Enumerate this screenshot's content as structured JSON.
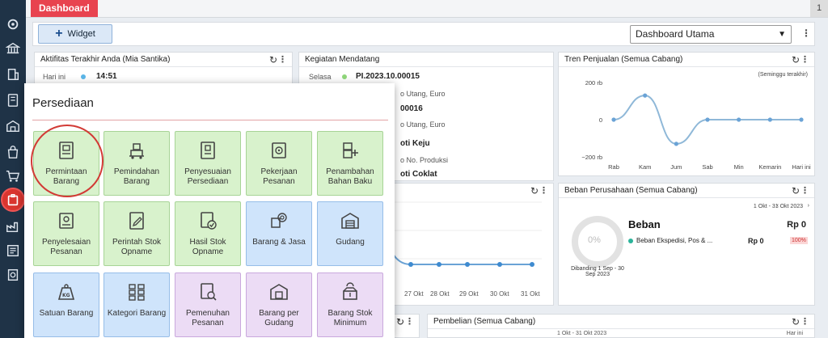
{
  "topbar": {
    "tab": "Dashboard",
    "right": "1"
  },
  "toolbar": {
    "widget_label": "Widget",
    "dashboard_select": "Dashboard Utama"
  },
  "activity": {
    "title": "Aktifitas Terakhir Anda (Mia Santika)",
    "row_label": "Hari ini",
    "row_time": "14:51"
  },
  "upcoming": {
    "title": "Kegiatan Mendatang",
    "status": "Selasa",
    "code": "PI.2023.10.00015",
    "lines": [
      "o Utang, Euro",
      "00016",
      "o Utang, Euro",
      "oti Keju",
      "o No. Produksi",
      "oti Coklat"
    ]
  },
  "sales": {
    "title": "Tren Penjualan (Semua Cabang)",
    "period": "(Seminggu terakhir)"
  },
  "expense": {
    "title": "Beban Perusahaan (Semua Cabang)",
    "range": "1 Okt - 31 Okt 2023",
    "donut_pct": "0%",
    "heading": "Beban",
    "total": "Rp 0",
    "item": "Beban Ekspedisi, Pos & ...",
    "item_value": "Rp 0",
    "item_pct": "100%",
    "compare": "Dibanding 1 Sep - 30 Sep 2023"
  },
  "middle_chart": {
    "xlabels": [
      "27 Okt",
      "28 Okt",
      "29 Okt",
      "30 Okt",
      "31 Okt"
    ]
  },
  "purchases": {
    "title": "Pembelian (Semua Cabang)",
    "range": "1 Okt - 31 Okt 2023",
    "range_right": "Har ini"
  },
  "menu": {
    "title": "Persediaan",
    "tiles": [
      "Permintaan Barang",
      "Pemindahan Barang",
      "Penyesuaian Persediaan",
      "Pekerjaan Pesanan",
      "Penambahan Bahan Baku",
      "Penyelesaian Pesanan",
      "Perintah Stok Opname",
      "Hasil Stok Opname",
      "Barang & Jasa",
      "Gudang",
      "Satuan Barang",
      "Kategori Barang",
      "Pemenuhan Pesanan",
      "Barang per Gudang",
      "Barang Stok Minimum"
    ]
  },
  "chart_data": {
    "type": "line",
    "title": "Tren Penjualan (Semua Cabang)",
    "categories": [
      "Rab",
      "Kam",
      "Jum",
      "Sab",
      "Min",
      "Kemarin",
      "Hari ini"
    ],
    "values": [
      0,
      130,
      -130,
      0,
      0,
      0,
      0
    ],
    "yticks": [
      "200 rb",
      "0",
      "−200 rb"
    ],
    "ylim": [
      -200,
      200
    ],
    "colors": {
      "line": "#8fb8d8",
      "point": "#6aa3d6"
    }
  }
}
